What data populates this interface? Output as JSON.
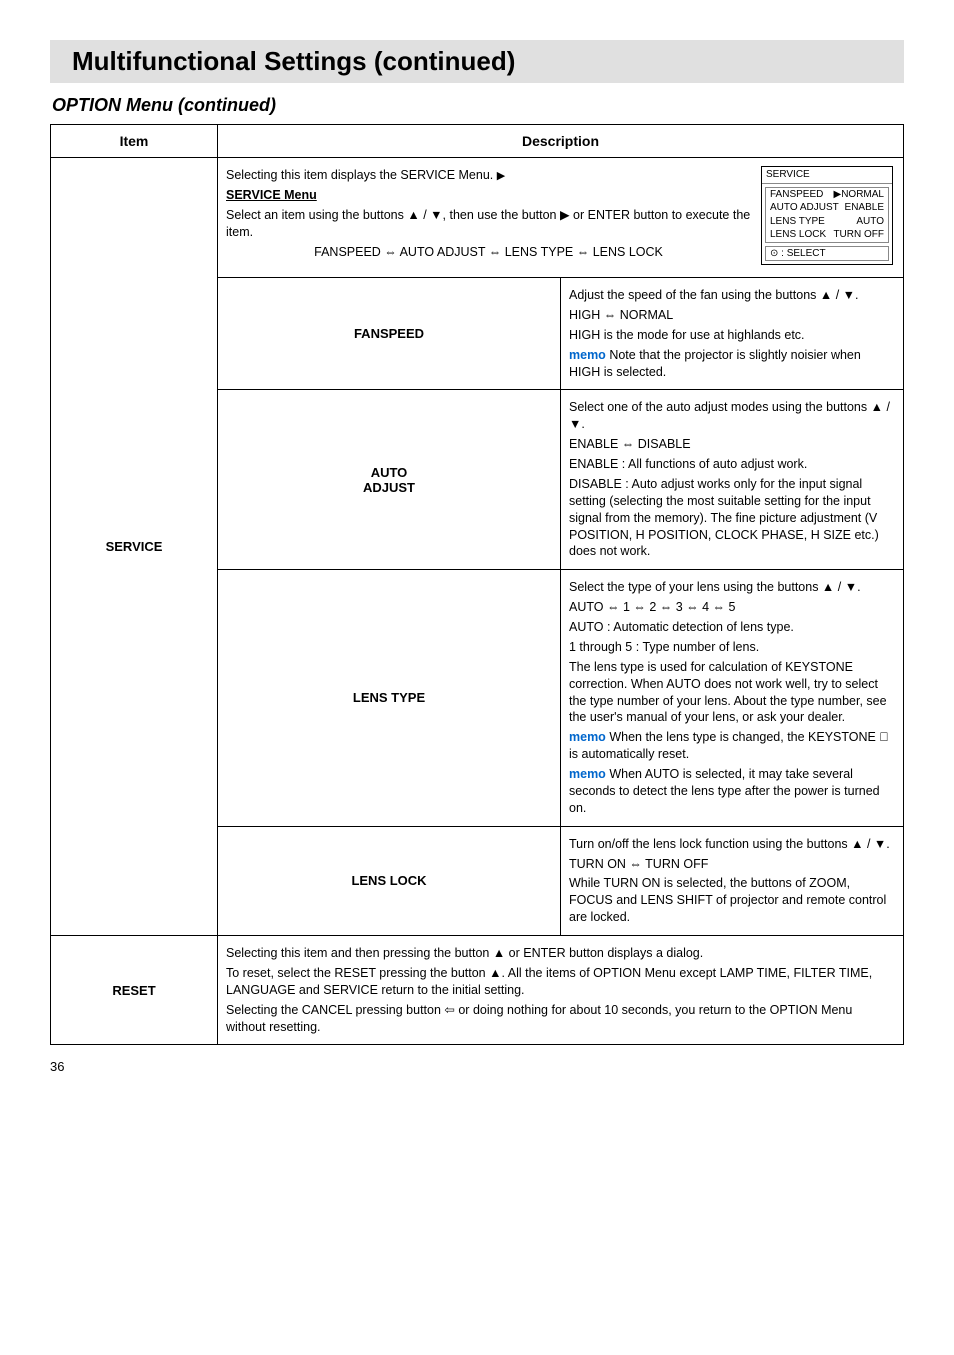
{
  "page_title": "Multifunctional Settings (continued)",
  "subtitle": "OPTION Menu (continued)",
  "header_item": "Item",
  "header_desc": "Description",
  "service_label": "SERVICE",
  "reset_label": "RESET",
  "osd": {
    "title": "SERVICE",
    "rows": [
      {
        "l": "FANSPEED",
        "r": "▶NORMAL"
      },
      {
        "l": "AUTO ADJUST",
        "r": "ENABLE"
      },
      {
        "l": "LENS TYPE",
        "r": "AUTO"
      },
      {
        "l": "LENS LOCK",
        "r": "TURN OFF"
      }
    ],
    "foot": "⊙ : SELECT"
  },
  "service_menu": {
    "heading_pre": "Selecting this item displays the SERVICE Menu.",
    "heading_link": "SERVICE Menu",
    "line1a": "Select an item using the buttons ▲ / ▼, then use the button ▶ or ENTER button to execute the item.",
    "line2": "FANSPEED ⇔ AUTO ADJUST ⇔ LENS TYPE ⇔ LENS LOCK"
  },
  "fanspeed": {
    "label": "FANSPEED",
    "l1": "Adjust the speed of the fan using the buttons ▲ / ▼.",
    "l2": "HIGH ⇔ NORMAL",
    "l3": "HIGH is the mode for use at highlands etc.",
    "memo": "memo  Note that the projector is slightly noisier when HIGH is selected."
  },
  "autoadjust": {
    "label": "AUTO ADJUST",
    "l1": "Select one of the auto adjust modes using the buttons ▲ / ▼.",
    "l2": "ENABLE ⇔ DISABLE",
    "l3": "ENABLE  : All functions of auto adjust work.",
    "l4": "DISABLE : Auto adjust works only for the input signal setting (selecting the most suitable setting for the input signal from the memory). The fine picture adjustment (V POSITION, H POSITION, CLOCK PHASE, H SIZE etc.) does not work."
  },
  "lenstype": {
    "label": "LENS TYPE",
    "l1": "Select the type of your lens using the buttons ▲ / ▼.",
    "l2": "AUTO ⇔ 1 ⇔ 2 ⇔ 3 ⇔ 4 ⇔ 5",
    "l3": "AUTO : Automatic detection of lens type.",
    "l4": "1 through 5 : Type number of lens.",
    "l5": "The lens type is used for calculation of KEYSTONE correction. When AUTO does not work well, try to select the type number of your lens. About the type number, see the user's manual of your lens, or ask your dealer.",
    "memo1": "memo  When the lens type is changed, the KEYSTONE 󰀃 is automatically reset.",
    "memo2": "memo  When AUTO is selected, it may take several seconds to detect the lens type after the power is turned on."
  },
  "lenslock": {
    "label": "LENS LOCK",
    "l1": "Turn on/off the lens lock function using the buttons ▲ / ▼.",
    "l2": "TURN ON ⇔ TURN OFF",
    "l3": "While TURN ON is selected, the buttons of ZOOM, FOCUS and LENS SHIFT of projector and remote control are locked."
  },
  "reset": {
    "l1": "Selecting this item and then pressing the button ▲ or ENTER button displays a dialog.",
    "l2": "To reset, select the RESET pressing the button ▲. All the items of OPTION Menu except LAMP TIME, FILTER TIME, LANGUAGE and SERVICE return to the initial setting.",
    "l3": "Selecting the CANCEL pressing button ⇦ or doing nothing for about 10 seconds, you return to the OPTION Menu without resetting."
  },
  "page_number": "36"
}
